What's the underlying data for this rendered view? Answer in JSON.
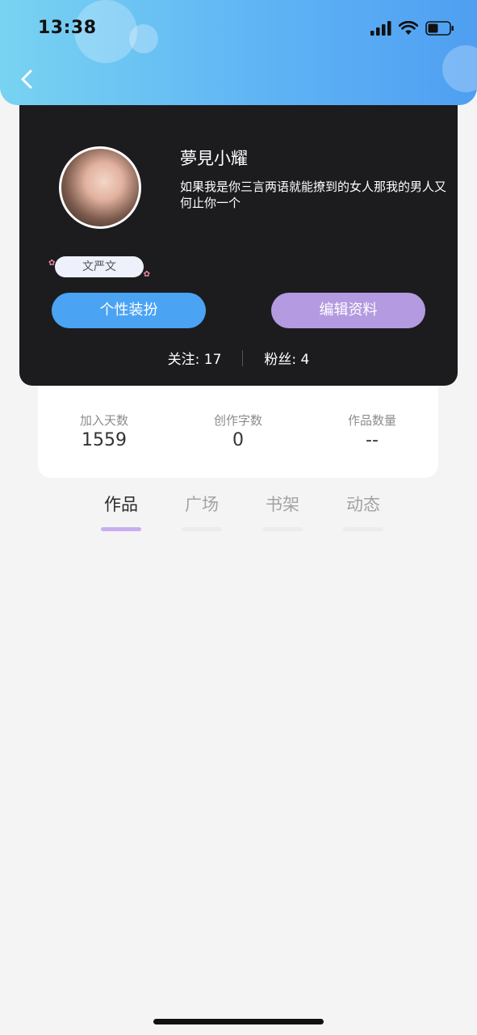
{
  "status_bar": {
    "time": "13:38"
  },
  "profile": {
    "username": "夢見小耀",
    "bio": "如果我是你三言两语就能撩到的女人那我的男人又何止你一个",
    "badge": "文严文",
    "buttons": {
      "dress_up": "个性装扮",
      "edit_profile": "编辑资料"
    },
    "follow": {
      "following_label": "关注:",
      "following_count": "17",
      "fans_label": "粉丝:",
      "fans_count": "4"
    }
  },
  "stats": [
    {
      "label": "加入天数",
      "value": "1559"
    },
    {
      "label": "创作字数",
      "value": "0"
    },
    {
      "label": "作品数量",
      "value": "--"
    }
  ],
  "tabs": [
    {
      "label": "作品",
      "active": true
    },
    {
      "label": "广场",
      "active": false
    },
    {
      "label": "书架",
      "active": false
    },
    {
      "label": "动态",
      "active": false
    }
  ],
  "colors": {
    "header_gradient_start": "#78d3f2",
    "header_gradient_end": "#4f9ff2",
    "card_dark": "#1c1c1e",
    "btn_dress": "#4aa3f3",
    "btn_edit": "#b49ae0",
    "tab_indicator": "#c8aef0"
  },
  "icons": {
    "back": "chevron-left-icon",
    "signal": "signal-icon",
    "wifi": "wifi-icon",
    "battery": "battery-icon"
  }
}
